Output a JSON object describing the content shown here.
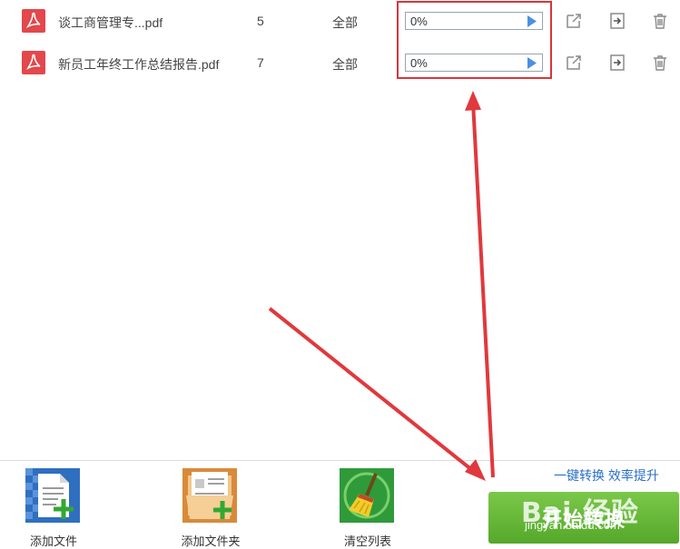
{
  "files": [
    {
      "name": "谈工商管理专...pdf",
      "pages": "5",
      "range": "全部",
      "progress_text": "0%",
      "progress": 0
    },
    {
      "name": "新员工年终工作总结报告.pdf",
      "pages": "7",
      "range": "全部",
      "progress_text": "0%",
      "progress": 0
    }
  ],
  "toolbar": {
    "add_file_label": "添加文件",
    "add_folder_label": "添加文件夹",
    "clear_list_label": "清空列表"
  },
  "slogan": "一键转换  效率提升",
  "start_button_label": "开始转换",
  "watermark": {
    "main": "Bai 经验",
    "sub": "jingyan.baidu.com"
  },
  "colors": {
    "pdf_icon": "#e2484c",
    "highlight": "#d8363a",
    "start_button": "#5cb030",
    "slogan": "#2a6fc4",
    "play_triangle": "#4a90e2"
  },
  "icons": {
    "file_type": "pdf-icon",
    "row_actions": [
      "open-external-icon",
      "export-icon",
      "trash-icon"
    ],
    "add_file": "add-file-icon",
    "add_folder": "add-folder-icon",
    "clear_list": "broom-icon"
  }
}
